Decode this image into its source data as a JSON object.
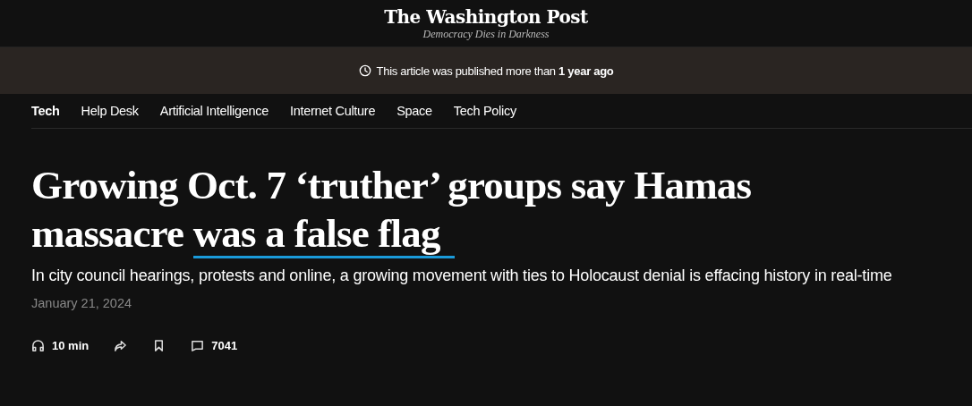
{
  "masthead": {
    "logo": "The Washington Post",
    "tagline": "Democracy Dies in Darkness"
  },
  "notice": {
    "text": "This article was published more than ",
    "emphasis": "1 year ago"
  },
  "nav": [
    {
      "label": "Tech",
      "selected": true
    },
    {
      "label": "Help Desk",
      "selected": false
    },
    {
      "label": "Artificial Intelligence",
      "selected": false
    },
    {
      "label": "Internet Culture",
      "selected": false
    },
    {
      "label": "Space",
      "selected": false
    },
    {
      "label": "Tech Policy",
      "selected": false
    }
  ],
  "headline": {
    "text": "Growing Oct. 7 ‘truther’ groups say Hamas massacre ",
    "underlined": "was a false flag"
  },
  "subheadline": "In city council hearings, protests and online, a growing movement with ties to Holocaust denial is effacing history in real-time",
  "date": "January 21, 2024",
  "actions": [
    {
      "kind": "listen",
      "label": "10 min"
    },
    {
      "kind": "share"
    },
    {
      "kind": "save"
    },
    {
      "kind": "comments",
      "label": "7041"
    }
  ]
}
